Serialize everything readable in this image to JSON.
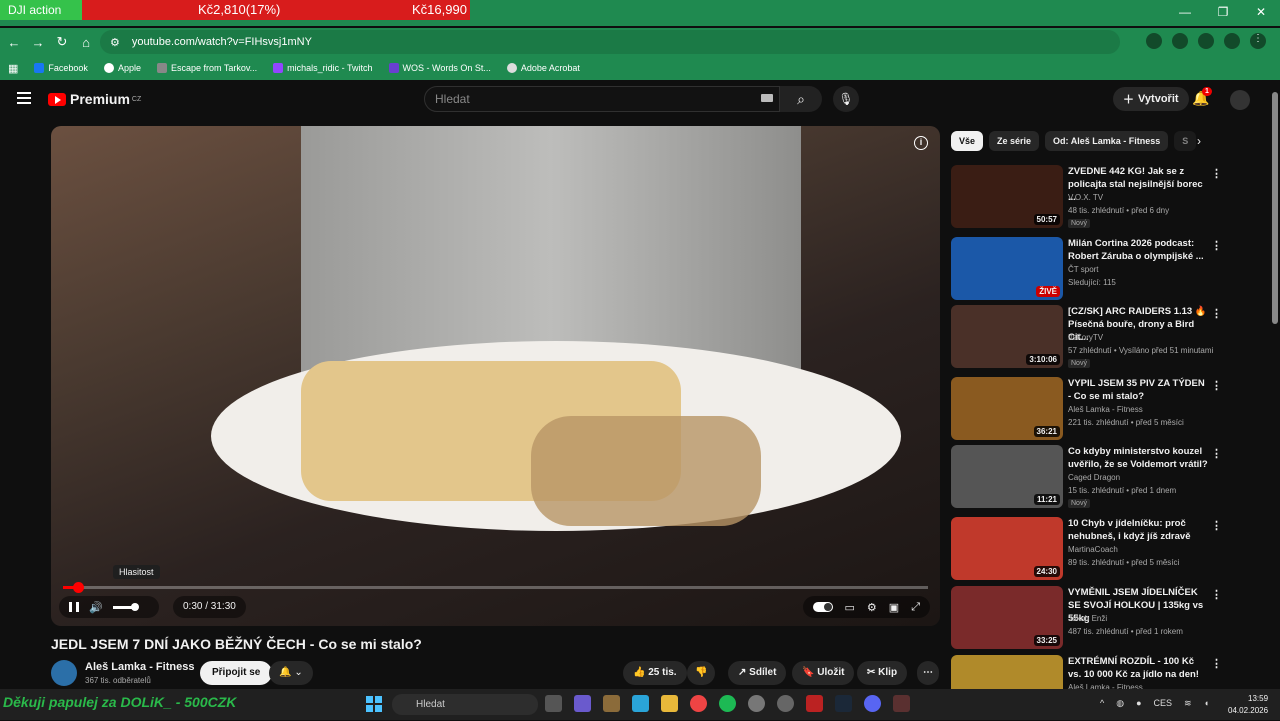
{
  "alert": {
    "action": "DJI action",
    "price_change": "Kč2,810(17%)",
    "price": "Kč16,990"
  },
  "browser": {
    "url": "youtube.com/watch?v=FIHsvsj1mNY",
    "bookmarks": [
      "Facebook",
      "Apple",
      "Escape from Tarkov...",
      "michals_ridic - Twitch",
      "WOS - Words On St...",
      "Adobe Acrobat"
    ]
  },
  "header": {
    "logo": "Premium",
    "logo_region": "CZ",
    "search_placeholder": "Hledat",
    "create_label": "Vytvořit",
    "notif_count": "1"
  },
  "player": {
    "volume_tooltip": "Hlasitost",
    "time": "0:30 / 31:30",
    "progress": 0.016,
    "volume": 0.8
  },
  "video": {
    "title": "JEDL JSEM 7 DNÍ JAKO BĚŽNÝ ČECH - Co se mi stalo?",
    "channel": "Aleš Lamka - Fitness",
    "subscribers": "367 tis. odběratelů",
    "subscribe_label": "Připojit se",
    "likes": "25 tis.",
    "share": "Sdílet",
    "save": "Uložit",
    "clip": "Klip"
  },
  "chips": [
    "Vše",
    "Ze série",
    "Od: Aleš Lamka - Fitness",
    "S"
  ],
  "recs": [
    {
      "title": "ZVEDNE 442 KG! Jak se z policajta stal nejsilnější borec ...",
      "channel": "V.O.X. TV",
      "meta": "48 tis. zhlédnutí • před 6 dny",
      "badge": "Nový",
      "dur": "50:57",
      "color": "#3a1d14"
    },
    {
      "title": "Milán Cortina 2026 podcast: Robert Záruba o olympijské ...",
      "channel": "ČT sport",
      "meta": "Sledující: 115",
      "badge": "",
      "dur": "ŽIVĚ",
      "color": "#1b58a8",
      "live": true
    },
    {
      "title": "[CZ/SK] ARC RAIDERS 1.13 🔥 Písečná bouře, drony a Bird Cit...",
      "channel": "ItsKoryTV",
      "meta": "57 zhlédnutí • Vysíláno před 51 minutami",
      "badge": "Nový",
      "dur": "3:10:06",
      "color": "#4a3028"
    },
    {
      "title": "VYPIL JSEM 35 PIV ZA TÝDEN - Co se mi stalo?",
      "channel": "Aleš Lamka - Fitness",
      "meta": "221 tis. zhlédnutí • před 5 měsíci",
      "badge": "",
      "dur": "36:21",
      "color": "#8a5a20"
    },
    {
      "title": "Co kdyby ministerstvo kouzel uvěřilo, že se Voldemort vrátil?",
      "channel": "Caged Dragon",
      "meta": "15 tis. zhlédnutí • před 1 dnem",
      "badge": "Nový",
      "dur": "11:21",
      "color": "#555"
    },
    {
      "title": "10 Chyb v jídelníčku: proč nehubneš, i když jíš zdravě",
      "channel": "MartinaCoach",
      "meta": "89 tis. zhlédnutí • před 5 měsíci",
      "badge": "",
      "dur": "24:30",
      "color": "#c0392b"
    },
    {
      "title": "VYMĚNIL JSEM JÍDELNÍČEK SE SVOJÍ HOLKOU | 135kg vs 55kg",
      "channel": "Jakub Enži",
      "meta": "487 tis. zhlédnutí • před 1 rokem",
      "badge": "",
      "dur": "33:25",
      "color": "#7a2a2a"
    },
    {
      "title": "EXTRÉMNÍ ROZDÍL - 100 Kč vs. 10 000 Kč za jídlo na den!",
      "channel": "Aleš Lamka - Fitness",
      "meta": "",
      "badge": "",
      "dur": "",
      "color": "#b08a2a"
    }
  ],
  "taskbar": {
    "overlay": "Děkuji papulej za DOLiK_ - 500CZK",
    "search": "Hledat",
    "lang": "CES",
    "time": "13:59",
    "date": "04.02.2026"
  }
}
